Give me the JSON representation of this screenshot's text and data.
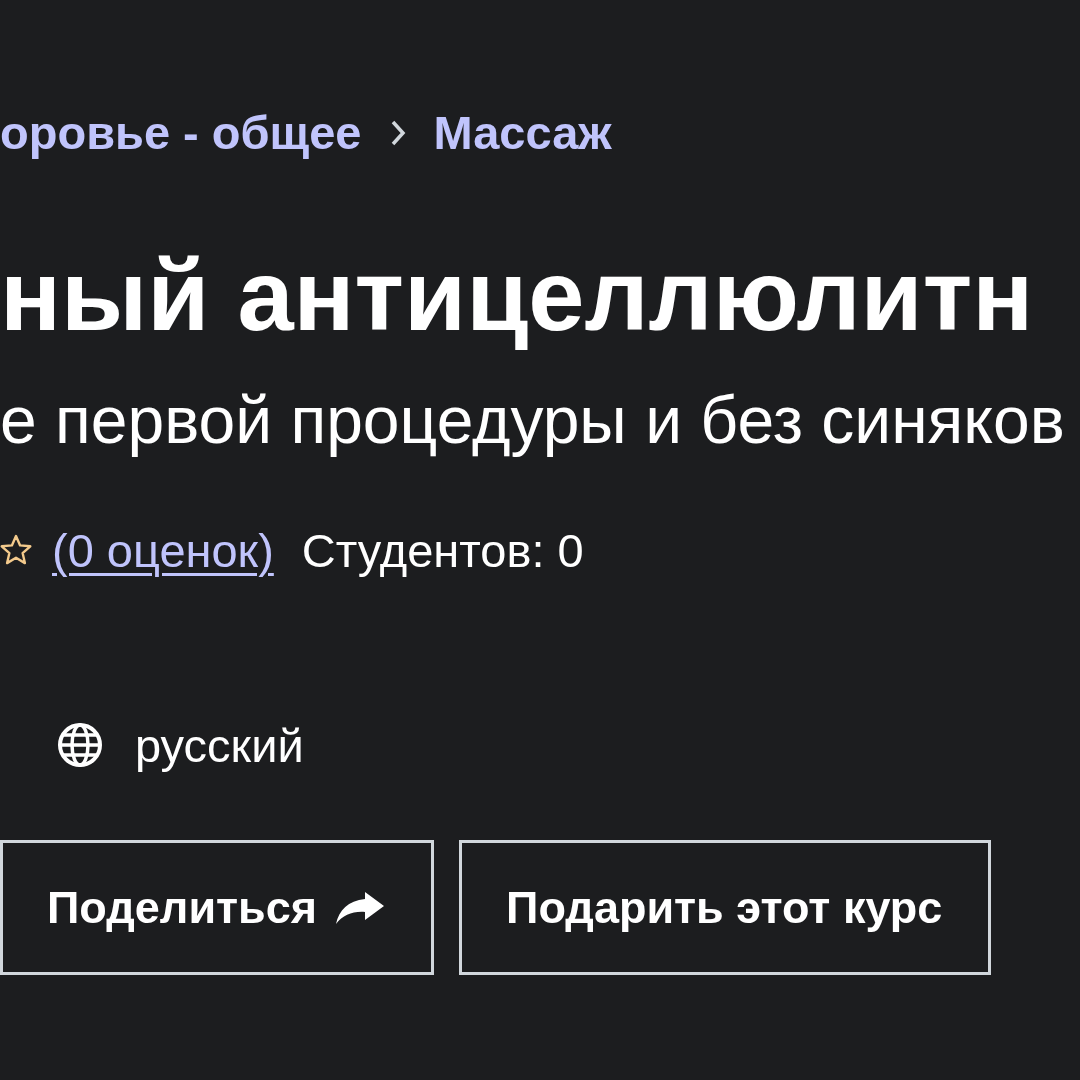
{
  "breadcrumb": {
    "items": [
      {
        "label": "оровье - общее"
      },
      {
        "label": "Массаж"
      }
    ]
  },
  "course": {
    "title": "ный антицеллюлитн",
    "subtitle": "е первой процедуры и без синяков",
    "rating": {
      "link": "(0 оценок)"
    },
    "students": "Студентов: 0",
    "language": "русский"
  },
  "buttons": [
    {
      "kind": "share",
      "label": "Поделиться"
    },
    {
      "kind": "gift",
      "label": "Подарить этот курс"
    }
  ]
}
